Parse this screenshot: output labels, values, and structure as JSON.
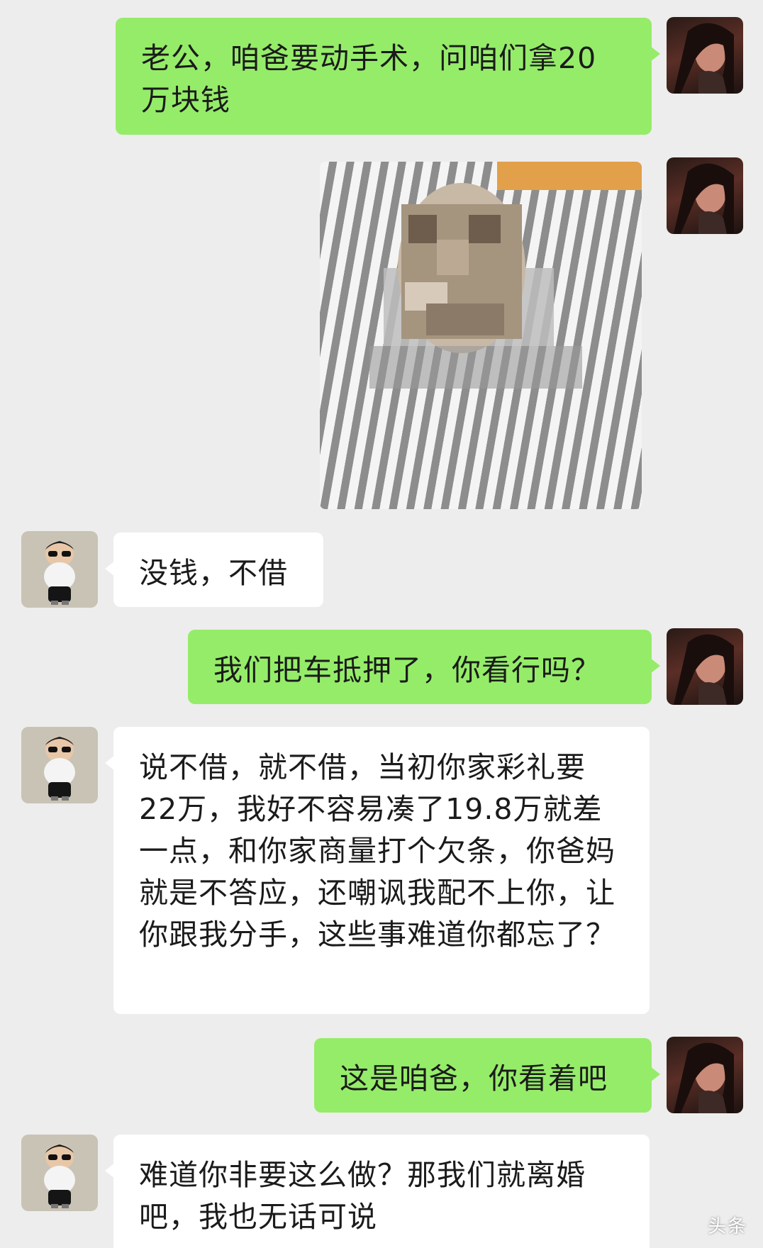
{
  "chat": {
    "messages": [
      {
        "id": 1,
        "sender": "self",
        "type": "text",
        "text": "老公，咱爸要动手术，问咱们拿20万块钱"
      },
      {
        "id": 2,
        "sender": "self",
        "type": "image",
        "icon": "hospital-bed-photo"
      },
      {
        "id": 3,
        "sender": "other",
        "type": "text",
        "text": "没钱，不借"
      },
      {
        "id": 4,
        "sender": "self",
        "type": "text",
        "text": "我们把车抵押了，你看行吗？"
      },
      {
        "id": 5,
        "sender": "other",
        "type": "text",
        "text": "说不借，就不借，当初你家彩礼要22万，我好不容易凑了19.8万就差一点，和你家商量打个欠条，你爸妈就是不答应，还嘲讽我配不上你，让你跟我分手，这些事难道你都忘了？"
      },
      {
        "id": 6,
        "sender": "self",
        "type": "text",
        "text": "这是咱爸，你看着吧"
      },
      {
        "id": 7,
        "sender": "other",
        "type": "text",
        "text": "难道你非要这么做？那我们就离婚吧，我也无话可说"
      }
    ]
  },
  "colors": {
    "self_bubble": "#95ec69",
    "other_bubble": "#ffffff",
    "background": "#ededed"
  },
  "avatars": {
    "self": "woman-photo-avatar",
    "other": "cartoon-boy-sunglasses-avatar"
  },
  "watermark": "头条"
}
